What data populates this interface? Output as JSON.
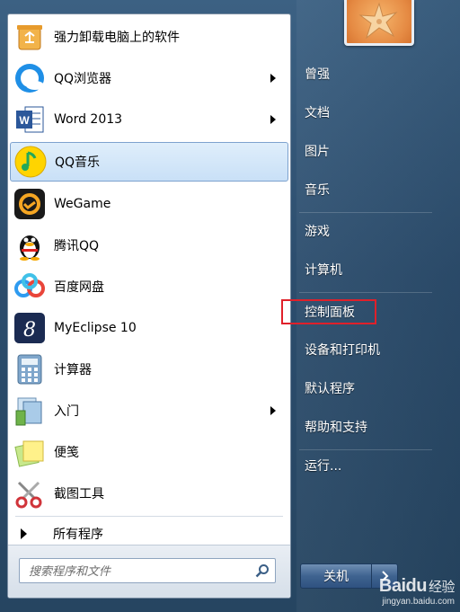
{
  "programs": [
    {
      "label": "强力卸载电脑上的软件",
      "icon": "recycle-bin-icon",
      "has_arrow": false
    },
    {
      "label": "QQ浏览器",
      "icon": "qq-browser-icon",
      "has_arrow": true
    },
    {
      "label": "Word 2013",
      "icon": "word-icon",
      "has_arrow": true
    },
    {
      "label": "QQ音乐",
      "icon": "qq-music-icon",
      "has_arrow": false,
      "selected": true
    },
    {
      "label": "WeGame",
      "icon": "wegame-icon",
      "has_arrow": false
    },
    {
      "label": "腾讯QQ",
      "icon": "qq-penguin-icon",
      "has_arrow": false
    },
    {
      "label": "百度网盘",
      "icon": "baidu-netdisk-icon",
      "has_arrow": false
    },
    {
      "label": "MyEclipse 10",
      "icon": "myeclipse-icon",
      "has_arrow": false
    },
    {
      "label": "计算器",
      "icon": "calculator-icon",
      "has_arrow": false
    },
    {
      "label": "入门",
      "icon": "getting-started-icon",
      "has_arrow": true
    },
    {
      "label": "便笺",
      "icon": "sticky-notes-icon",
      "has_arrow": false
    },
    {
      "label": "截图工具",
      "icon": "snipping-tool-icon",
      "has_arrow": false
    }
  ],
  "all_programs": {
    "label": "所有程序"
  },
  "search": {
    "placeholder": "搜索程序和文件"
  },
  "right_items": [
    {
      "label": "曾强"
    },
    {
      "label": "文档"
    },
    {
      "label": "图片"
    },
    {
      "label": "音乐"
    },
    {
      "label": "游戏"
    },
    {
      "label": "计算机"
    },
    {
      "label": "控制面板",
      "highlighted": true
    },
    {
      "label": "设备和打印机"
    },
    {
      "label": "默认程序"
    },
    {
      "label": "帮助和支持"
    },
    {
      "label": "运行..."
    }
  ],
  "shutdown": {
    "label": "关机"
  },
  "watermark": {
    "brand": "Baidu",
    "suffix": "经验",
    "url": "jingyan.baidu.com"
  },
  "colors": {
    "highlight_border": "#e0202a",
    "selected_bg": "#c9e0f7"
  }
}
